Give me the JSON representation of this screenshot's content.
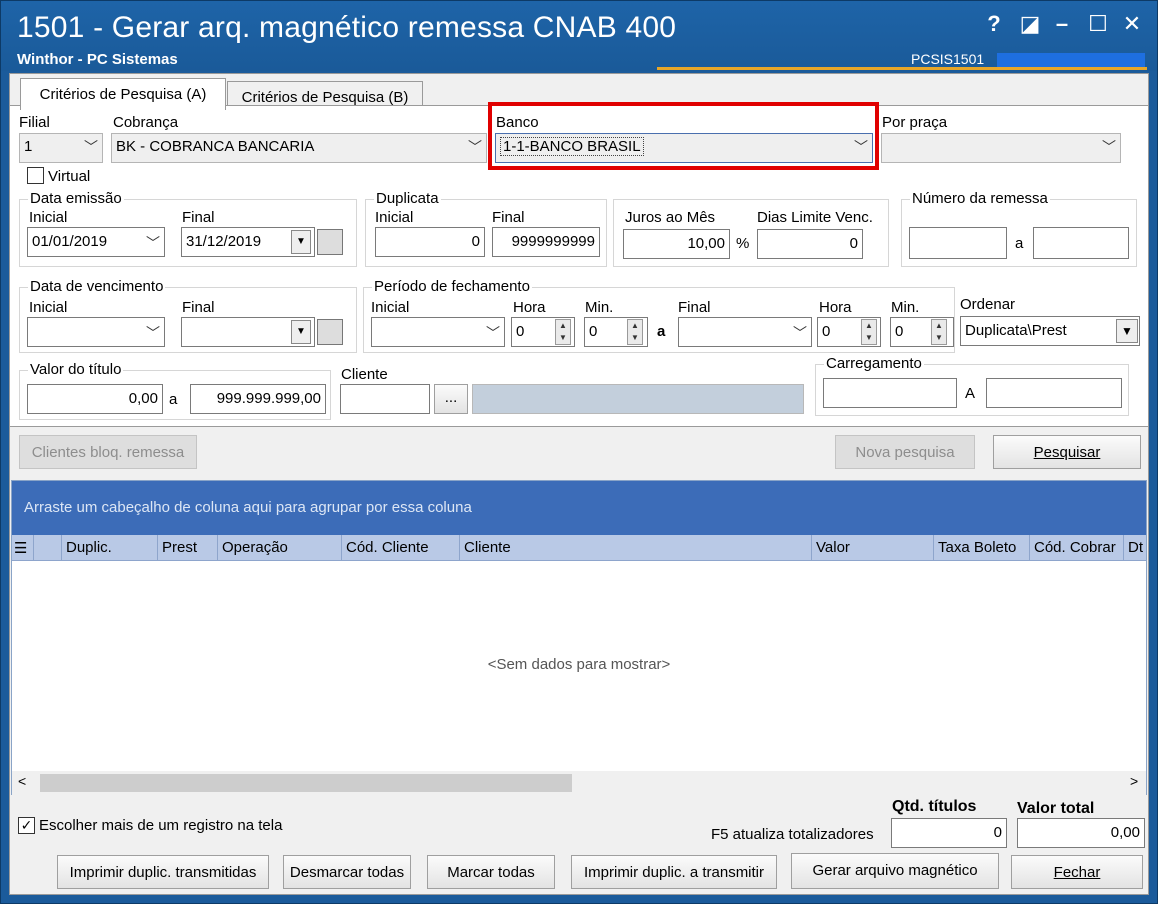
{
  "window": {
    "title": "1501 - Gerar arq. magnético remessa CNAB 400",
    "subtitle": "Winthor - PC Sistemas",
    "routine_code": "PCSIS1501",
    "controls": {
      "help": "?",
      "dock": "◪",
      "minimize": "–",
      "maximize": "☐",
      "close": "✕"
    }
  },
  "tabs": [
    {
      "label": "Critérios de Pesquisa (A)",
      "active": true
    },
    {
      "label": "Critérios de Pesquisa (B)",
      "active": false
    }
  ],
  "filters": {
    "filial_label": "Filial",
    "filial_value": "1",
    "cobranca_label": "Cobrança",
    "cobranca_value": "BK - COBRANCA BANCARIA",
    "banco_label": "Banco",
    "banco_value": "1-1-BANCO BRASIL",
    "praca_label": "Por praça",
    "praca_value": "",
    "virtual_label": "Virtual"
  },
  "data_emissao": {
    "title": "Data emissão",
    "inicial_label": "Inicial",
    "inicial_value": "01/01/2019",
    "final_label": "Final",
    "final_value": "31/12/2019"
  },
  "duplicata": {
    "title": "Duplicata",
    "inicial_label": "Inicial",
    "inicial_value": "0",
    "final_label": "Final",
    "final_value": "9999999999"
  },
  "juros": {
    "juros_label": "Juros ao Mês",
    "juros_value": "10,00",
    "percent": "%",
    "dias_label": "Dias Limite Venc.",
    "dias_value": "0"
  },
  "remessa": {
    "title": "Número da remessa",
    "sep": "a"
  },
  "vencimento": {
    "title": "Data de vencimento",
    "inicial_label": "Inicial",
    "final_label": "Final"
  },
  "fechamento": {
    "title": "Período de fechamento",
    "inicial_label": "Inicial",
    "hora_label": "Hora",
    "min_label": "Min.",
    "hora_value": "0",
    "min_value": "0",
    "sep": "a",
    "final_label": "Final",
    "hora2_label": "Hora",
    "min2_label": "Min.",
    "hora2_value": "0",
    "min2_value": "0"
  },
  "ordenar": {
    "label": "Ordenar",
    "value": "Duplicata\\Prest"
  },
  "valor_titulo": {
    "title": "Valor do título",
    "from": "0,00",
    "sep": "a",
    "to": "999.999.999,00"
  },
  "cliente": {
    "label": "Cliente",
    "browse": "..."
  },
  "carregamento": {
    "title": "Carregamento",
    "sep": "A"
  },
  "actions": {
    "clientes_bloq": "Clientes bloq. remessa",
    "nova_pesquisa": "Nova pesquisa",
    "pesquisar": "Pesquisar"
  },
  "grid": {
    "group_hint": "Arraste um cabeçalho de coluna aqui para agrupar por essa coluna",
    "columns": [
      "Duplic.",
      "Prest",
      "Operação",
      "Cód. Cliente",
      "Cliente",
      "Valor",
      "Taxa Boleto",
      "Cód. Cobrar",
      "Dt"
    ],
    "empty_text": "<Sem dados para mostrar>"
  },
  "footer": {
    "multi_select_label": "Escolher mais de um registro na tela",
    "f5_hint": "F5 atualiza totalizadores",
    "qtd_label": "Qtd. títulos",
    "qtd_value": "0",
    "valor_label": "Valor total",
    "valor_value": "0,00",
    "buttons": {
      "imprimir_transmitidas": "Imprimir duplic. transmitidas",
      "desmarcar": "Desmarcar todas",
      "marcar": "Marcar todas",
      "imprimir_transmitir": "Imprimir duplic. a transmitir",
      "gerar": "Gerar arquivo magnético",
      "fechar": "Fechar"
    }
  },
  "colors": {
    "titlebar": "#1a5a99",
    "accent": "#e7a628",
    "grid_banner": "#3c6cb8",
    "grid_header": "#b9c9e6",
    "highlight": "#e00000"
  }
}
